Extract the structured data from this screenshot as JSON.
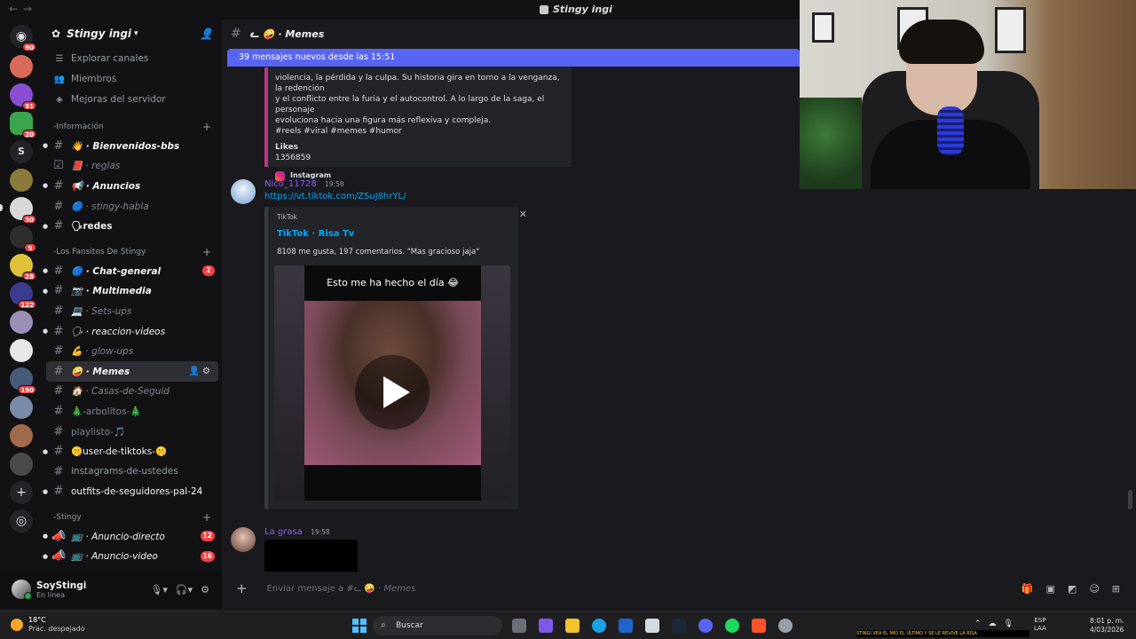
{
  "window": {
    "title": "Stingy ingi"
  },
  "server": {
    "name": "Stingy ingi",
    "nav": [
      "Explorar canales",
      "Miembros",
      "Mejoras del servidor"
    ],
    "categories": [
      {
        "name": "-Información",
        "channels": [
          {
            "name": "Bienvenidos-bbs",
            "emoji": "👋"
          },
          {
            "name": "reglas",
            "emoji": "📕"
          },
          {
            "name": "Anuncios",
            "emoji": "📢"
          },
          {
            "name": "stingy-habla",
            "emoji": "🔵"
          },
          {
            "name": "redes",
            "emoji": "🗣"
          }
        ]
      },
      {
        "name": "-Los Fansitos De Stingy",
        "channels": [
          {
            "name": "Chat-general",
            "emoji": "🔵",
            "badge": "2"
          },
          {
            "name": "Multimedia",
            "emoji": "📷"
          },
          {
            "name": "Sets-ups",
            "emoji": "💻"
          },
          {
            "name": "reaccion-videos",
            "emoji": "🗣"
          },
          {
            "name": "glow-ups",
            "emoji": "💪"
          },
          {
            "name": "Memes",
            "emoji": "🤪"
          },
          {
            "name": "Casas-de-Seguid",
            "emoji": "🏠"
          },
          {
            "name": "-arbolitos-",
            "emoji": "🎄"
          },
          {
            "name": "playlisto-",
            "emoji": "🎵"
          },
          {
            "name": "user-de-tiktoks-",
            "emoji": "🤫"
          },
          {
            "name": "instagrams-de-ustedes",
            "emoji": ""
          },
          {
            "name": "outfits-de-seguidores-pal-24",
            "emoji": ""
          }
        ]
      },
      {
        "name": "-Stingy",
        "channels": [
          {
            "name": "Anuncio-directo",
            "emoji": "📺",
            "badge": "12"
          },
          {
            "name": "Anuncio-video",
            "emoji": "📺",
            "badge": "16"
          }
        ]
      }
    ]
  },
  "rail": {
    "badges": [
      "90",
      "91",
      "20",
      "30",
      "5",
      "28",
      "122",
      "190"
    ],
    "letter": "S"
  },
  "user": {
    "name": "SoyStingi",
    "status": "En línea"
  },
  "channel": {
    "name": "Memes",
    "prefix": "ᓚ",
    "new_messages_bar": "39 mensajes nuevos desde las 15:51",
    "composer_placeholder": "Enviar mensaje a #",
    "composer_channel": "Memes"
  },
  "messages": {
    "embed_top": {
      "desc_lines": [
        "violencia, la pérdida y la culpa. Su historia gira en torno a la venganza, la redención",
        "y el conflicto entre la furia y el autocontrol. A lo largo de la saga, el personaje",
        "evoluciona hacia una figura más reflexiva y compleja.",
        "#reels #viral #memes #humor"
      ],
      "likes_label": "Likes",
      "likes_value": "1356859",
      "provider": "Instagram"
    },
    "msg1": {
      "author": "Nico_11728",
      "time": "19:58",
      "link": "https://vt.tiktok.com/ZSuJ8hrYL/",
      "embed": {
        "provider": "TikTok",
        "title": "TikTok · Risa Tv",
        "description": "8108 me gusta, 197 comentarios. \"Mas gracioso jaja\"",
        "video_caption": "Esto me ha hecho el día 😂"
      }
    },
    "msg2": {
      "author": "La grasa",
      "time": "19:58"
    }
  },
  "taskbar": {
    "temp": "18°C",
    "condition": "Prac. despejado",
    "search": "Buscar",
    "lang_top": "ESP",
    "lang_bottom": "LAA",
    "time": "8:01 p. m.",
    "date": "4/03/2026"
  },
  "ticker": "STINGI VEA EL MÍO EL ÚLTIMO Y SE LE REVIVE LA RISA",
  "colors": {
    "accent": "#5865f2",
    "link": "#00a8fc",
    "badge": "#f23f43",
    "instagram_border": "#c13584"
  }
}
